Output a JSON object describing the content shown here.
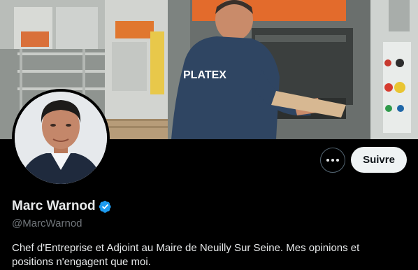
{
  "banner": {
    "shirt_logo_text": "PLATEX"
  },
  "profile": {
    "display_name": "Marc Warnod",
    "handle": "@MarcWarnod",
    "bio": "Chef d'Entreprise et Adjoint au Maire de Neuilly Sur Seine. Mes opinions et positions n'engagent que moi.",
    "verified": true
  },
  "actions": {
    "more_icon": "more-horizontal-icon",
    "follow_label": "Suivre"
  },
  "colors": {
    "background": "#000000",
    "verified_blue": "#1d9bf0",
    "follow_bg": "#eff3f4",
    "handle_gray": "#71767b"
  }
}
